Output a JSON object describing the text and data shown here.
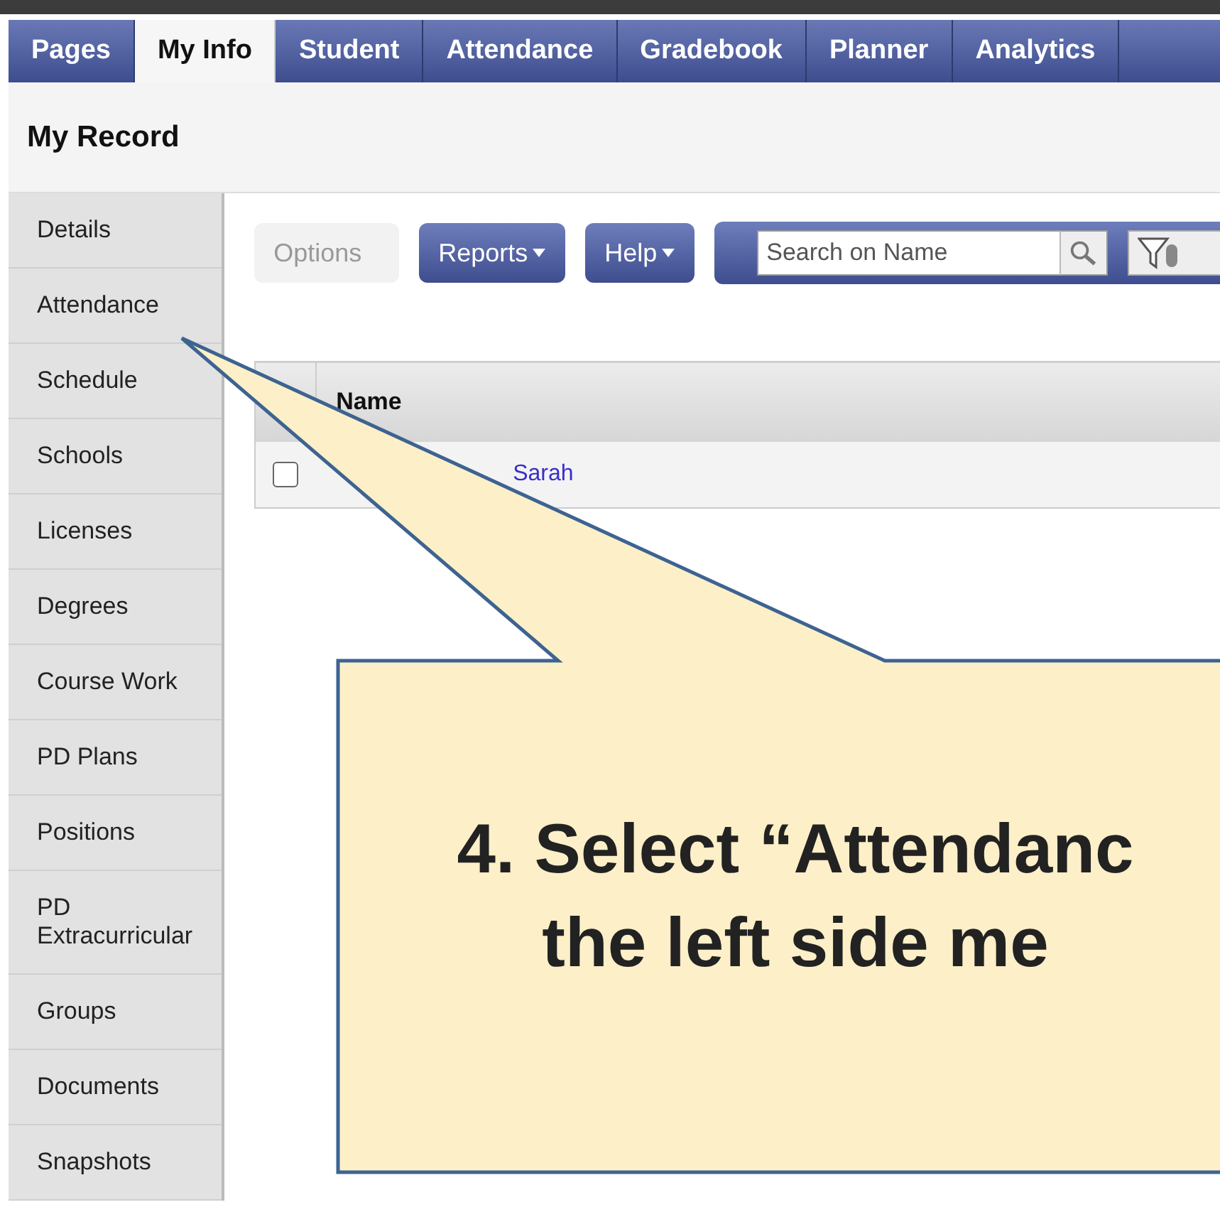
{
  "tabs": [
    {
      "label": "Pages",
      "selected": false
    },
    {
      "label": "My Info",
      "selected": true
    },
    {
      "label": "Student",
      "selected": false
    },
    {
      "label": "Attendance",
      "selected": false
    },
    {
      "label": "Gradebook",
      "selected": false
    },
    {
      "label": "Planner",
      "selected": false
    },
    {
      "label": "Analytics",
      "selected": false
    }
  ],
  "page_title": "My Record",
  "sidebar": {
    "items": [
      {
        "label": "Details"
      },
      {
        "label": "Attendance"
      },
      {
        "label": "Schedule"
      },
      {
        "label": "Schools"
      },
      {
        "label": "Licenses"
      },
      {
        "label": "Degrees"
      },
      {
        "label": "Course Work"
      },
      {
        "label": "PD Plans"
      },
      {
        "label": "Positions"
      },
      {
        "label": "PD Extracurricular"
      },
      {
        "label": "Groups"
      },
      {
        "label": "Documents"
      },
      {
        "label": "Snapshots"
      }
    ]
  },
  "toolbar": {
    "buttons": [
      {
        "label": "Options",
        "disabled": true
      },
      {
        "label": "Reports",
        "disabled": false
      },
      {
        "label": "Help",
        "disabled": false
      }
    ],
    "search": {
      "placeholder": "Search on Name"
    }
  },
  "table": {
    "columns": [
      "Name"
    ],
    "rows": [
      {
        "checked": false,
        "name": "Sarah"
      }
    ]
  },
  "callout": {
    "lines": [
      "4. Select “Attendanc",
      "the left side me"
    ]
  }
}
